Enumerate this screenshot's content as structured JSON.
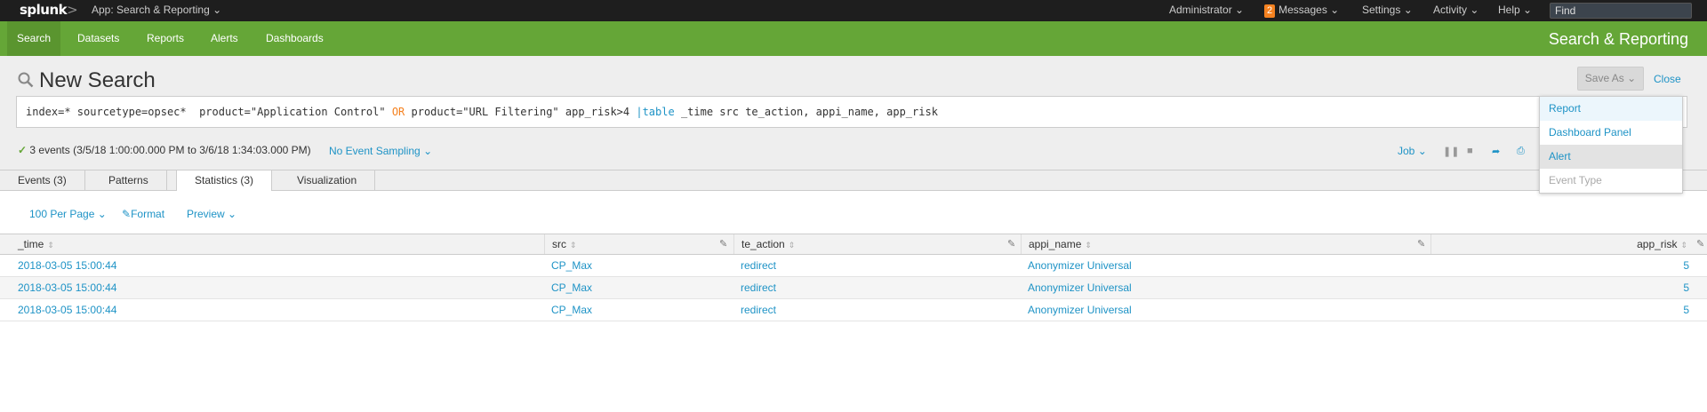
{
  "topbar": {
    "logo": "splunk",
    "logo_chevron": ">",
    "app_menu": "App: Search & Reporting",
    "user_menu": "Administrator",
    "messages_count": "2",
    "messages_label": "Messages",
    "settings_label": "Settings",
    "activity_label": "Activity",
    "help_label": "Help",
    "find_placeholder": "Find"
  },
  "nav": {
    "items": [
      {
        "label": "Search"
      },
      {
        "label": "Datasets"
      },
      {
        "label": "Reports"
      },
      {
        "label": "Alerts"
      },
      {
        "label": "Dashboards"
      }
    ],
    "app_title": "Search & Reporting"
  },
  "search": {
    "title": "New Search",
    "save_as_label": "Save As",
    "close_label": "Close",
    "query_part1": "index=* sourcetype=opsec*  product=\"Application Control\" ",
    "query_or": "OR",
    "query_part2": " product=\"URL Filtering\" app_risk>4 ",
    "query_pipe": "|table",
    "query_part3": " _time src te_action, appi_name, app_risk",
    "status_text": "3 events (3/5/18 1:00:00.000 PM to 3/6/18 1:34:03.000 PM)",
    "sampling_label": "No Event Sampling",
    "job_label": "Job"
  },
  "save_as_menu": {
    "items": [
      {
        "label": "Report"
      },
      {
        "label": "Dashboard Panel"
      },
      {
        "label": "Alert"
      },
      {
        "label": "Event Type"
      }
    ]
  },
  "tabs": [
    {
      "label": "Events (3)"
    },
    {
      "label": "Patterns"
    },
    {
      "label": "Statistics (3)"
    },
    {
      "label": "Visualization"
    }
  ],
  "controls": {
    "per_page": "100 Per Page",
    "format": "Format",
    "preview": "Preview"
  },
  "table": {
    "columns": [
      "_time",
      "src",
      "te_action",
      "appi_name",
      "app_risk"
    ],
    "rows": [
      [
        "2018-03-05 15:00:44",
        "CP_Max",
        "redirect",
        "Anonymizer Universal",
        "5"
      ],
      [
        "2018-03-05 15:00:44",
        "CP_Max",
        "redirect",
        "Anonymizer Universal",
        "5"
      ],
      [
        "2018-03-05 15:00:44",
        "CP_Max",
        "redirect",
        "Anonymizer Universal",
        "5"
      ]
    ]
  },
  "colors": {
    "nav_green": "#65a637",
    "link_blue": "#1e93c6",
    "accent_orange": "#f58220"
  }
}
